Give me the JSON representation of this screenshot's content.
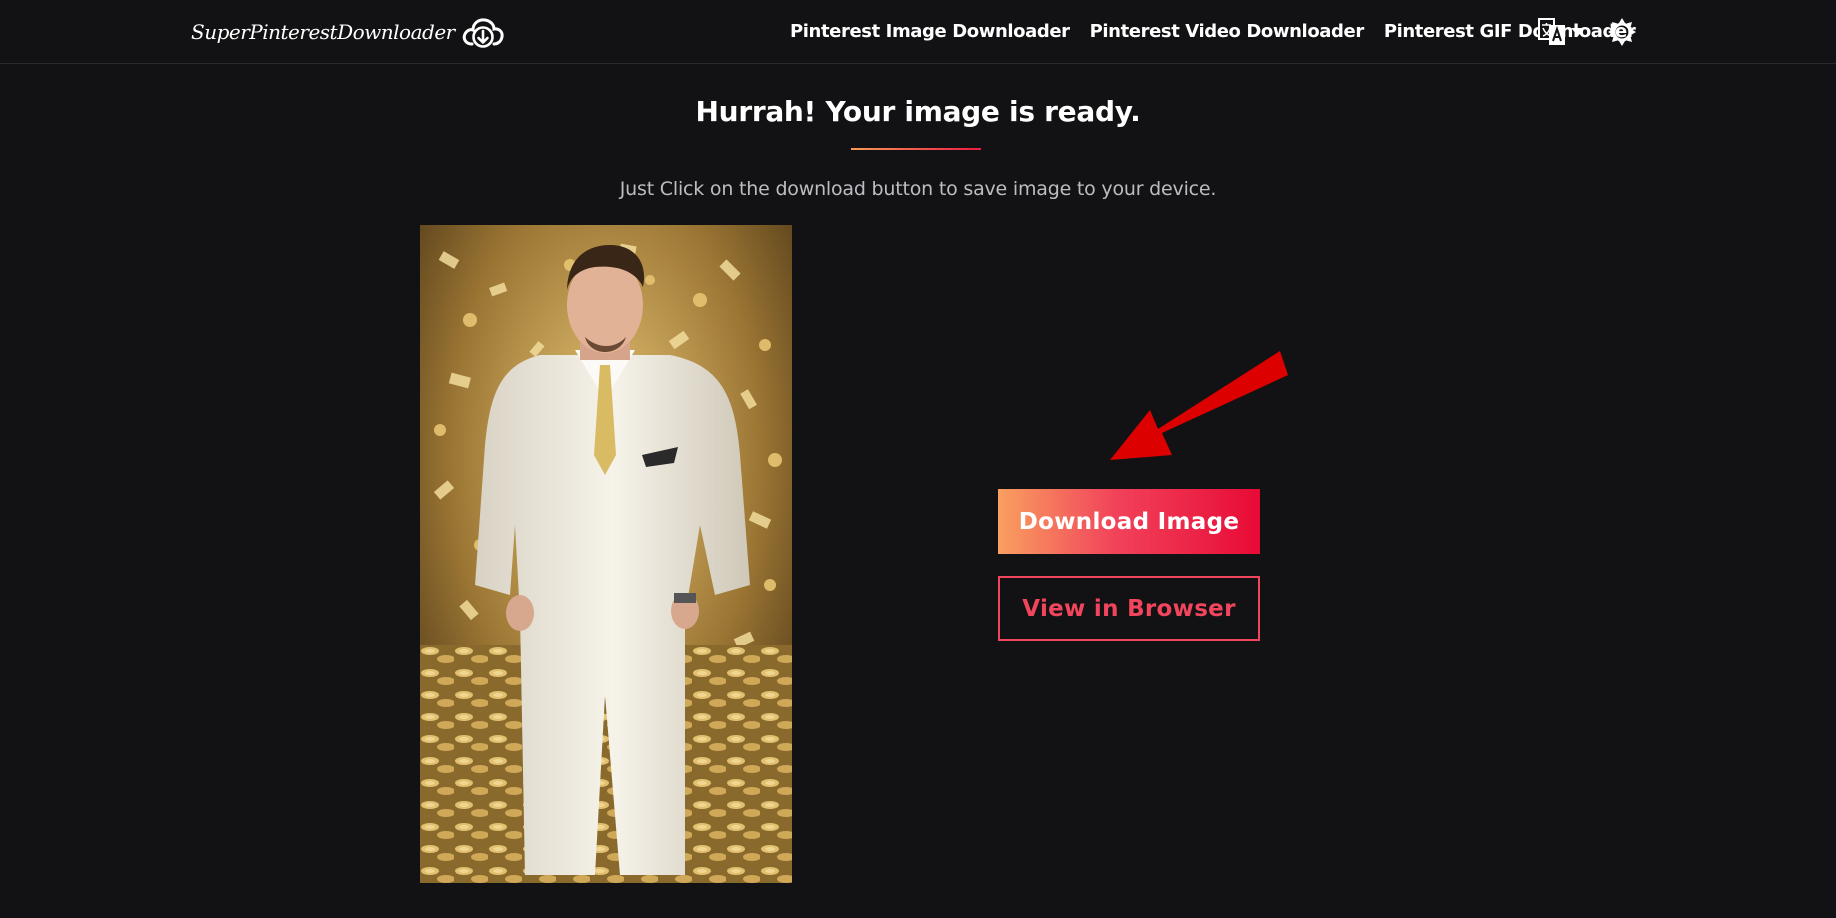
{
  "header": {
    "logo_text": "SuperPinterestDownloader",
    "logo_icon": "cloud-download-icon",
    "nav": [
      {
        "label": "Pinterest Image Downloader"
      },
      {
        "label": "Pinterest Video Downloader"
      },
      {
        "label": "Pinterest GIF Downloader"
      }
    ],
    "language_icon": "translate-icon",
    "theme_icon": "sun-icon"
  },
  "main": {
    "title": "Hurrah! Your image is ready.",
    "subtitle": "Just Click on the download button to save image to your device.",
    "download_label": "Download Image",
    "view_label": "View in Browser",
    "arrow_icon": "red-arrow-icon"
  },
  "colors": {
    "background": "#121214",
    "accent_start": "#f9a060",
    "accent_end": "#e80a36",
    "outline_red": "#f0455c",
    "arrow_red": "#dd0000"
  }
}
